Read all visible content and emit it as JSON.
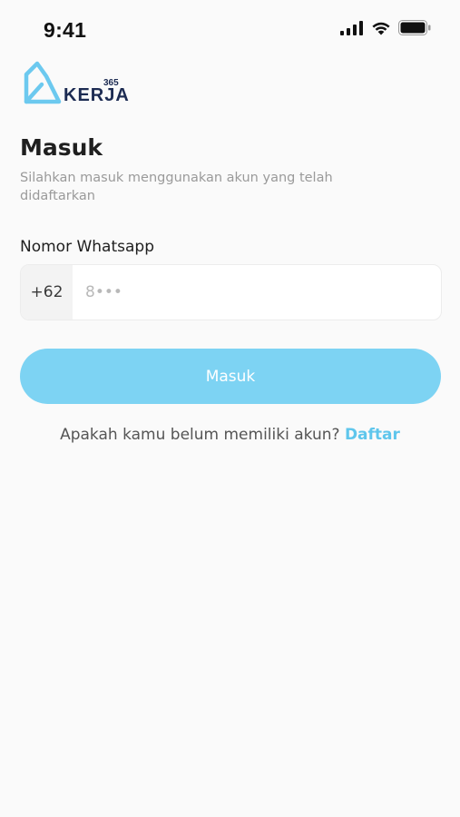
{
  "status_bar": {
    "time": "9:41",
    "icons": [
      "cellular-signal-icon",
      "wifi-icon",
      "battery-icon"
    ]
  },
  "logo": {
    "superscript": "365",
    "wordmark": "KERJA",
    "icon": "kerja-logo-icon"
  },
  "login": {
    "title": "Masuk",
    "subtitle": "Silahkan masuk menggunakan akun yang telah didaftarkan",
    "phone_label": "Nomor Whatsapp",
    "country_code": "+62",
    "phone_placeholder": "8•••",
    "phone_value": "",
    "submit_label": "Masuk",
    "signup_prompt": "Apakah kamu belum memiliki akun?",
    "signup_link": "Daftar"
  },
  "colors": {
    "accent": "#7dd3f3",
    "link": "#5fc6ec",
    "brand_dark": "#1c2b52",
    "logo_icon": "#6cc9ef"
  }
}
